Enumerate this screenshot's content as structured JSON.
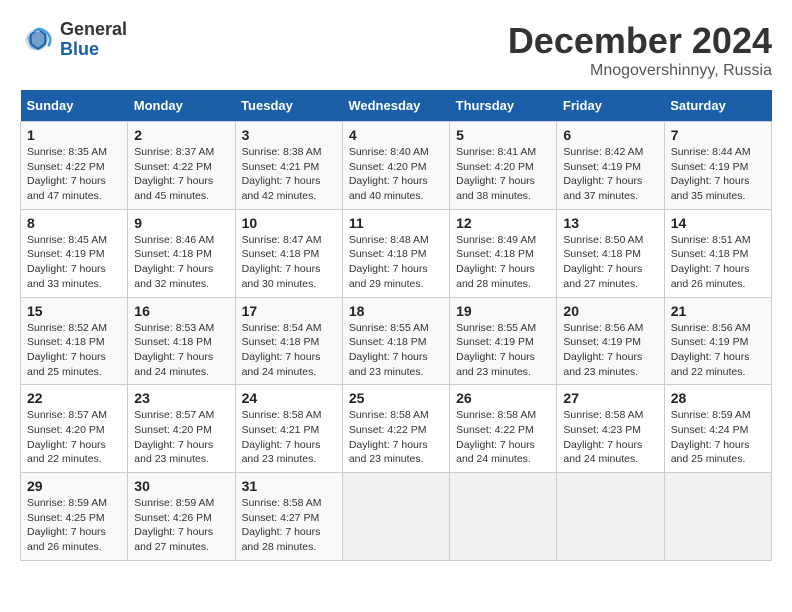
{
  "header": {
    "logo_line1": "General",
    "logo_line2": "Blue",
    "month": "December 2024",
    "location": "Mnogovershinnyy, Russia"
  },
  "weekdays": [
    "Sunday",
    "Monday",
    "Tuesday",
    "Wednesday",
    "Thursday",
    "Friday",
    "Saturday"
  ],
  "weeks": [
    [
      {
        "day": "1",
        "sunrise": "8:35 AM",
        "sunset": "4:22 PM",
        "daylight": "7 hours and 47 minutes."
      },
      {
        "day": "2",
        "sunrise": "8:37 AM",
        "sunset": "4:22 PM",
        "daylight": "7 hours and 45 minutes."
      },
      {
        "day": "3",
        "sunrise": "8:38 AM",
        "sunset": "4:21 PM",
        "daylight": "7 hours and 42 minutes."
      },
      {
        "day": "4",
        "sunrise": "8:40 AM",
        "sunset": "4:20 PM",
        "daylight": "7 hours and 40 minutes."
      },
      {
        "day": "5",
        "sunrise": "8:41 AM",
        "sunset": "4:20 PM",
        "daylight": "7 hours and 38 minutes."
      },
      {
        "day": "6",
        "sunrise": "8:42 AM",
        "sunset": "4:19 PM",
        "daylight": "7 hours and 37 minutes."
      },
      {
        "day": "7",
        "sunrise": "8:44 AM",
        "sunset": "4:19 PM",
        "daylight": "7 hours and 35 minutes."
      }
    ],
    [
      {
        "day": "8",
        "sunrise": "8:45 AM",
        "sunset": "4:19 PM",
        "daylight": "7 hours and 33 minutes."
      },
      {
        "day": "9",
        "sunrise": "8:46 AM",
        "sunset": "4:18 PM",
        "daylight": "7 hours and 32 minutes."
      },
      {
        "day": "10",
        "sunrise": "8:47 AM",
        "sunset": "4:18 PM",
        "daylight": "7 hours and 30 minutes."
      },
      {
        "day": "11",
        "sunrise": "8:48 AM",
        "sunset": "4:18 PM",
        "daylight": "7 hours and 29 minutes."
      },
      {
        "day": "12",
        "sunrise": "8:49 AM",
        "sunset": "4:18 PM",
        "daylight": "7 hours and 28 minutes."
      },
      {
        "day": "13",
        "sunrise": "8:50 AM",
        "sunset": "4:18 PM",
        "daylight": "7 hours and 27 minutes."
      },
      {
        "day": "14",
        "sunrise": "8:51 AM",
        "sunset": "4:18 PM",
        "daylight": "7 hours and 26 minutes."
      }
    ],
    [
      {
        "day": "15",
        "sunrise": "8:52 AM",
        "sunset": "4:18 PM",
        "daylight": "7 hours and 25 minutes."
      },
      {
        "day": "16",
        "sunrise": "8:53 AM",
        "sunset": "4:18 PM",
        "daylight": "7 hours and 24 minutes."
      },
      {
        "day": "17",
        "sunrise": "8:54 AM",
        "sunset": "4:18 PM",
        "daylight": "7 hours and 24 minutes."
      },
      {
        "day": "18",
        "sunrise": "8:55 AM",
        "sunset": "4:18 PM",
        "daylight": "7 hours and 23 minutes."
      },
      {
        "day": "19",
        "sunrise": "8:55 AM",
        "sunset": "4:19 PM",
        "daylight": "7 hours and 23 minutes."
      },
      {
        "day": "20",
        "sunrise": "8:56 AM",
        "sunset": "4:19 PM",
        "daylight": "7 hours and 23 minutes."
      },
      {
        "day": "21",
        "sunrise": "8:56 AM",
        "sunset": "4:19 PM",
        "daylight": "7 hours and 22 minutes."
      }
    ],
    [
      {
        "day": "22",
        "sunrise": "8:57 AM",
        "sunset": "4:20 PM",
        "daylight": "7 hours and 22 minutes."
      },
      {
        "day": "23",
        "sunrise": "8:57 AM",
        "sunset": "4:20 PM",
        "daylight": "7 hours and 23 minutes."
      },
      {
        "day": "24",
        "sunrise": "8:58 AM",
        "sunset": "4:21 PM",
        "daylight": "7 hours and 23 minutes."
      },
      {
        "day": "25",
        "sunrise": "8:58 AM",
        "sunset": "4:22 PM",
        "daylight": "7 hours and 23 minutes."
      },
      {
        "day": "26",
        "sunrise": "8:58 AM",
        "sunset": "4:22 PM",
        "daylight": "7 hours and 24 minutes."
      },
      {
        "day": "27",
        "sunrise": "8:58 AM",
        "sunset": "4:23 PM",
        "daylight": "7 hours and 24 minutes."
      },
      {
        "day": "28",
        "sunrise": "8:59 AM",
        "sunset": "4:24 PM",
        "daylight": "7 hours and 25 minutes."
      }
    ],
    [
      {
        "day": "29",
        "sunrise": "8:59 AM",
        "sunset": "4:25 PM",
        "daylight": "7 hours and 26 minutes."
      },
      {
        "day": "30",
        "sunrise": "8:59 AM",
        "sunset": "4:26 PM",
        "daylight": "7 hours and 27 minutes."
      },
      {
        "day": "31",
        "sunrise": "8:58 AM",
        "sunset": "4:27 PM",
        "daylight": "7 hours and 28 minutes."
      },
      null,
      null,
      null,
      null
    ]
  ]
}
